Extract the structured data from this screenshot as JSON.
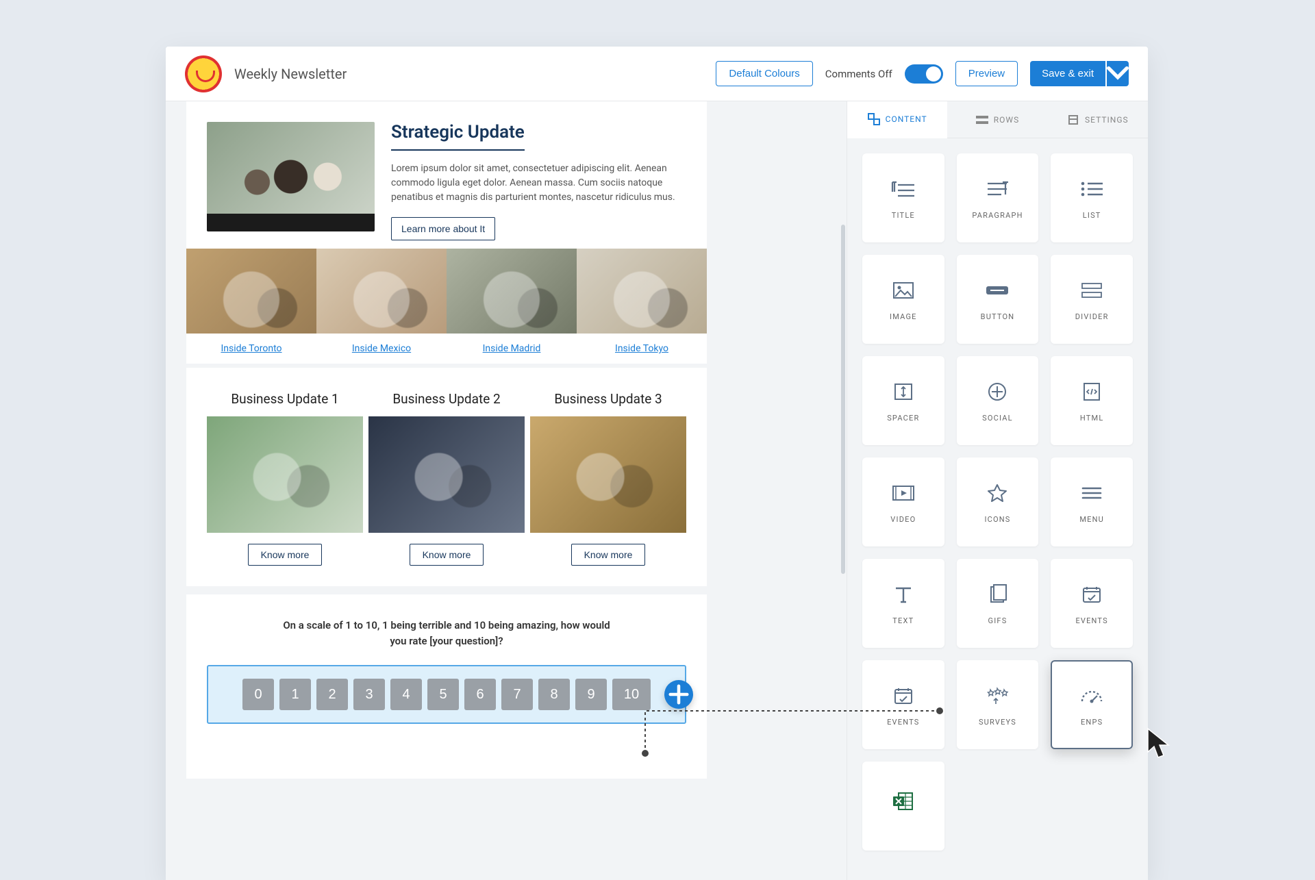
{
  "header": {
    "title": "Weekly Newsletter",
    "default_colours": "Default Colours",
    "comments_off": "Comments Off",
    "preview": "Preview",
    "save_exit": "Save & exit"
  },
  "canvas": {
    "strategic": {
      "title": "Strategic Update",
      "body": "Lorem ipsum dolor sit amet, consectetuer adipiscing elit. Aenean commodo ligula eget dolor. Aenean massa. Cum sociis natoque penatibus et magnis dis parturient montes, nascetur ridiculus mus.",
      "cta": "Learn more about It"
    },
    "cities": {
      "items": [
        {
          "label": "Inside Toronto"
        },
        {
          "label": "Inside Mexico"
        },
        {
          "label": "Inside Madrid"
        },
        {
          "label": "Inside Tokyo"
        }
      ]
    },
    "business": {
      "items": [
        {
          "title": "Business Update 1",
          "cta": "Know more"
        },
        {
          "title": "Business Update 2",
          "cta": "Know more"
        },
        {
          "title": "Business Update 3",
          "cta": "Know more"
        }
      ]
    },
    "rating": {
      "question": "On a scale of 1 to 10, 1 being terrible and 10 being amazing, how would you rate [your question]?",
      "options": [
        "0",
        "1",
        "2",
        "3",
        "4",
        "5",
        "6",
        "7",
        "8",
        "9",
        "10"
      ]
    }
  },
  "sidebar": {
    "tabs": {
      "content": "CONTENT",
      "rows": "ROWS",
      "settings": "SETTINGS"
    },
    "tiles": [
      {
        "id": "title",
        "label": "TITLE"
      },
      {
        "id": "paragraph",
        "label": "PARAGRAPH"
      },
      {
        "id": "list",
        "label": "LIST"
      },
      {
        "id": "image",
        "label": "IMAGE"
      },
      {
        "id": "button",
        "label": "BUTTON"
      },
      {
        "id": "divider",
        "label": "DIVIDER"
      },
      {
        "id": "spacer",
        "label": "SPACER"
      },
      {
        "id": "social",
        "label": "SOCIAL"
      },
      {
        "id": "html",
        "label": "HTML"
      },
      {
        "id": "video",
        "label": "VIDEO"
      },
      {
        "id": "icons",
        "label": "ICONS"
      },
      {
        "id": "menu",
        "label": "MENU"
      },
      {
        "id": "text",
        "label": "TEXT"
      },
      {
        "id": "gifs",
        "label": "GIFS"
      },
      {
        "id": "events",
        "label": "EVENTS"
      },
      {
        "id": "events2",
        "label": "EVENTS"
      },
      {
        "id": "surveys",
        "label": "SURVEYS"
      },
      {
        "id": "enps",
        "label": "ENPS"
      },
      {
        "id": "excel",
        "label": ""
      }
    ]
  }
}
